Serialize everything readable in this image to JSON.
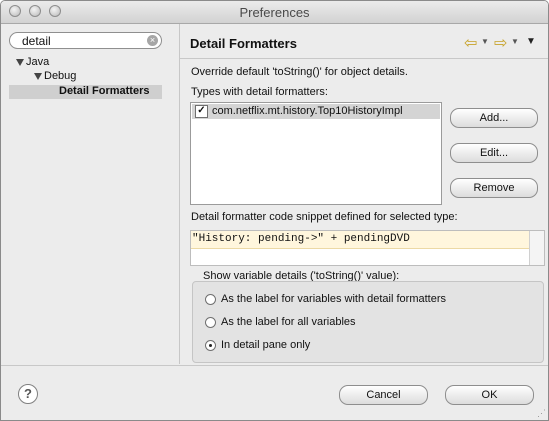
{
  "window": {
    "title": "Preferences"
  },
  "sidebar": {
    "search_value": "detail",
    "tree": [
      {
        "label": "Java"
      },
      {
        "label": "Debug"
      },
      {
        "label": "Detail Formatters"
      }
    ]
  },
  "page": {
    "title": "Detail Formatters",
    "override_text": "Override default 'toString()' for object details.",
    "types_label": "Types with detail formatters:",
    "types": [
      {
        "checked": true,
        "name": "com.netflix.mt.history.Top10HistoryImpl"
      }
    ],
    "buttons": {
      "add": "Add...",
      "edit": "Edit...",
      "remove": "Remove"
    },
    "snippet_label": "Detail formatter code snippet defined for selected type:",
    "snippet_code": "\"History: pending->\" + pendingDVD",
    "show_details": {
      "title": "Show variable details ('toString()' value):",
      "options": [
        {
          "label": "As the label for variables with detail formatters",
          "selected": false
        },
        {
          "label": "As the label for all variables",
          "selected": false
        },
        {
          "label": "In detail pane only",
          "selected": true
        }
      ]
    }
  },
  "footer": {
    "help": "?",
    "cancel": "Cancel",
    "ok": "OK"
  },
  "icons": {
    "nav_back": "back-arrow-icon",
    "nav_forward": "forward-arrow-icon",
    "view_menu": "chevron-down-icon"
  },
  "colors": {
    "nav_arrow": "#c7a32a",
    "snippet_highlight": "#fff6dd"
  }
}
